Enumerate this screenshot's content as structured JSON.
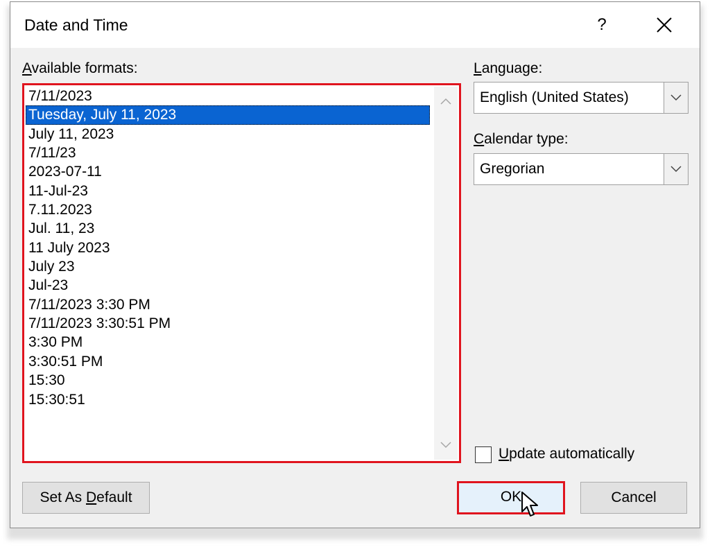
{
  "dialog": {
    "title": "Date and Time",
    "help_label": "?",
    "close_label": "close"
  },
  "formats": {
    "label_key": "A",
    "label_rest": "vailable formats:",
    "items": [
      "7/11/2023",
      "Tuesday, July 11, 2023",
      "July 11, 2023",
      "7/11/23",
      "2023-07-11",
      "11-Jul-23",
      "7.11.2023",
      "Jul. 11, 23",
      "11 July 2023",
      "July 23",
      "Jul-23",
      "7/11/2023 3:30 PM",
      "7/11/2023 3:30:51 PM",
      "3:30 PM",
      "3:30:51 PM",
      "15:30",
      "15:30:51"
    ],
    "selected_index": 1
  },
  "language": {
    "label_key": "L",
    "label_rest": "anguage:",
    "value": "English (United States)"
  },
  "calendar": {
    "label_key": "C",
    "label_rest": "alendar type:",
    "value": "Gregorian"
  },
  "update": {
    "label_key": "U",
    "label_rest": "pdate automatically",
    "checked": false
  },
  "buttons": {
    "set_default_pre": "Set As ",
    "set_default_key": "D",
    "set_default_post": "efault",
    "ok": "OK",
    "cancel": "Cancel"
  },
  "colors": {
    "highlight": "#0a64d2",
    "annotation_red": "#e0141e"
  }
}
